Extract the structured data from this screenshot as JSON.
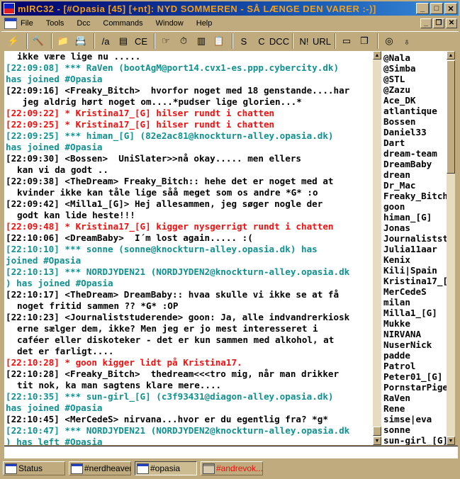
{
  "window": {
    "title": "mIRC32 - [#Opasia [45] [+nt]: NYD SOMMEREN - SÅ LÆNGE DEN VARER :-)]",
    "min": "_",
    "max": "□",
    "close": "✕"
  },
  "menu": {
    "items": [
      "File",
      "Tools",
      "Dcc",
      "Commands",
      "Window",
      "Help"
    ],
    "mdi_min": "_",
    "mdi_restore": "❐",
    "mdi_close": "✕"
  },
  "toolbar": {
    "buttons": [
      {
        "name": "connect",
        "glyph": "⚡"
      },
      {
        "sep": true
      },
      {
        "name": "options",
        "glyph": "🔨"
      },
      {
        "sep": true
      },
      {
        "name": "channels-folder",
        "glyph": "📁"
      },
      {
        "name": "address-book",
        "glyph": "📇"
      },
      {
        "sep": true
      },
      {
        "name": "aliases",
        "glyph": "/a"
      },
      {
        "name": "popups",
        "glyph": "▤"
      },
      {
        "name": "remote",
        "glyph": "CE"
      },
      {
        "sep": true
      },
      {
        "name": "finger",
        "glyph": "☞"
      },
      {
        "name": "timer",
        "glyph": "⏱"
      },
      {
        "name": "colors",
        "glyph": "▥"
      },
      {
        "name": "notes",
        "glyph": "📋"
      },
      {
        "sep": true
      },
      {
        "name": "dcc-send",
        "glyph": "S"
      },
      {
        "name": "dcc-chat",
        "glyph": "C"
      },
      {
        "name": "dcc-options",
        "glyph": "DCC"
      },
      {
        "sep": true
      },
      {
        "name": "notify",
        "glyph": "N!"
      },
      {
        "name": "url-list",
        "glyph": "URL"
      },
      {
        "sep": true
      },
      {
        "name": "tile",
        "glyph": "▭"
      },
      {
        "name": "cascade",
        "glyph": "❐"
      },
      {
        "sep": true
      },
      {
        "name": "help",
        "glyph": "◎"
      },
      {
        "name": "about",
        "glyph": "♁"
      }
    ]
  },
  "colors": {
    "title_text": "#f0a020",
    "normal": "#000000",
    "action": "#f01010",
    "join": "#109090",
    "frame": "#bfab7d"
  },
  "chat": {
    "rows": [
      {
        "t": "ikke være lige nu .....",
        "c": "black",
        "ind": true
      },
      {
        "t": "[22:09:08] *** RaVen (bootAgM@port14.cvx1-es.ppp.cybercity.dk)",
        "c": "teal"
      },
      {
        "t": "has joined #Opasia",
        "c": "teal"
      },
      {
        "t": "[22:09:16] <Freaky_Bitch>  hvorfor noget med 18 genstande....har",
        "c": "black"
      },
      {
        "t": " jeg aldrig hørt noget om....*pudser lige glorien...*",
        "c": "black",
        "ind": true
      },
      {
        "t": "[22:09:22] * Kristina17_[G] hilser rundt i chatten",
        "c": "red"
      },
      {
        "t": "[22:09:25] * Kristina17_[G] hilser rundt i chatten",
        "c": "red"
      },
      {
        "t": "[22:09:25] *** himan_[G] (82e2ac81@knockturn-alley.opasia.dk)",
        "c": "teal"
      },
      {
        "t": "has joined #Opasia",
        "c": "teal"
      },
      {
        "t": "[22:09:30] <Bossen>  UniSlater>>nå okay..... men ellers",
        "c": "black"
      },
      {
        "t": "kan vi da godt ..",
        "c": "black",
        "ind": true
      },
      {
        "t": "[22:09:38] <TheDream> Freaky_Bitch:: hehe det er noget med at",
        "c": "black"
      },
      {
        "t": "kvinder ikke kan tåle lige såå meget som os andre *G* :o",
        "c": "black",
        "ind": true
      },
      {
        "t": "[22:09:42] <Milla1_[G]> Hej allesammen, jeg søger nogle der",
        "c": "black"
      },
      {
        "t": "godt kan lide heste!!!",
        "c": "black",
        "ind": true
      },
      {
        "t": "[22:09:48] * Kristina17_[G] kigger nysgerrigt rundt i chatten",
        "c": "red"
      },
      {
        "t": "[22:10:06] <DreamBaby>  I´m lost again..... :(",
        "c": "black"
      },
      {
        "t": "[22:10:10] *** sonne (sonne@knockturn-alley.opasia.dk) has",
        "c": "teal"
      },
      {
        "t": "joined #Opasia",
        "c": "teal"
      },
      {
        "t": "[22:10:13] *** NORDJYDEN21 (NORDJYDEN2@knockturn-alley.opasia.dk",
        "c": "teal"
      },
      {
        "t": ") has joined #Opasia",
        "c": "teal"
      },
      {
        "t": "[22:10:17] <TheDream> DreamBaby:: hvaa skulle vi ikke se at få",
        "c": "black"
      },
      {
        "t": "noget fritid sammen ?? *G* :OP",
        "c": "black",
        "ind": true
      },
      {
        "t": "[22:10:23] <Journaliststuderende> goon: Ja, alle indvandrerkiosk",
        "c": "black"
      },
      {
        "t": "erne sælger dem, ikke? Men jeg er jo mest interesseret i",
        "c": "black",
        "ind": true
      },
      {
        "t": "caféer eller diskoteker - det er kun sammen med alkohol, at",
        "c": "black",
        "ind": true
      },
      {
        "t": "det er farligt....",
        "c": "black",
        "ind": true
      },
      {
        "t": "[22:10:28] * goon kigger lidt på Kristina17.",
        "c": "red"
      },
      {
        "t": "[22:10:28] <Freaky_Bitch>  thedream<<<tro mig, når man drikker",
        "c": "black"
      },
      {
        "t": "tit nok, ka man sagtens klare mere....",
        "c": "black",
        "ind": true
      },
      {
        "t": "[22:10:35] *** sun-girl_[G] (c3f93431@diagon-alley.opasia.dk)",
        "c": "teal"
      },
      {
        "t": "has joined #Opasia",
        "c": "teal"
      },
      {
        "t": "[22:10:45] <MerCedeS> nirvana...hvor er du egentlig fra? *g*",
        "c": "black"
      },
      {
        "t": "[22:10:47] *** NORDJYDEN21 (NORDJYDEN2@knockturn-alley.opasia.dk",
        "c": "teal"
      },
      {
        "t": ") has left #Opasia",
        "c": "teal"
      }
    ]
  },
  "nicklist": [
    "@Nala",
    "@Simba",
    "@STL",
    "@Zazu",
    "Ace_DK",
    "atlantique",
    "Bossen",
    "Daniel33",
    "Dart",
    "dream-team",
    "DreamBaby",
    "drean",
    "Dr_Mac",
    "Freaky_Bitch",
    "goon",
    "himan_[G]",
    "Jonas",
    "Journaliststuderende",
    "Julia11aar",
    "Kenix",
    "Kili|Spain",
    "Kristina17_[G]",
    "MerCedeS",
    "milan",
    "Milla1_[G]",
    "Mukke",
    "NIRVANA",
    "NuserNick",
    "padde",
    "Patrol",
    "Peter01_[G]",
    "PornstarPige",
    "RaVen",
    "Rene",
    "simse|eva",
    "sonne",
    "sun-girl_[G]"
  ],
  "input": {
    "value": ""
  },
  "switchbar": [
    {
      "label": "Status",
      "active": false,
      "dim": false
    },
    {
      "label": "#nerdheaven",
      "active": false,
      "dim": false
    },
    {
      "label": "#opasia",
      "active": true,
      "dim": false
    },
    {
      "label": "#andrevok...",
      "active": false,
      "dim": true,
      "color": "#f01010"
    }
  ]
}
